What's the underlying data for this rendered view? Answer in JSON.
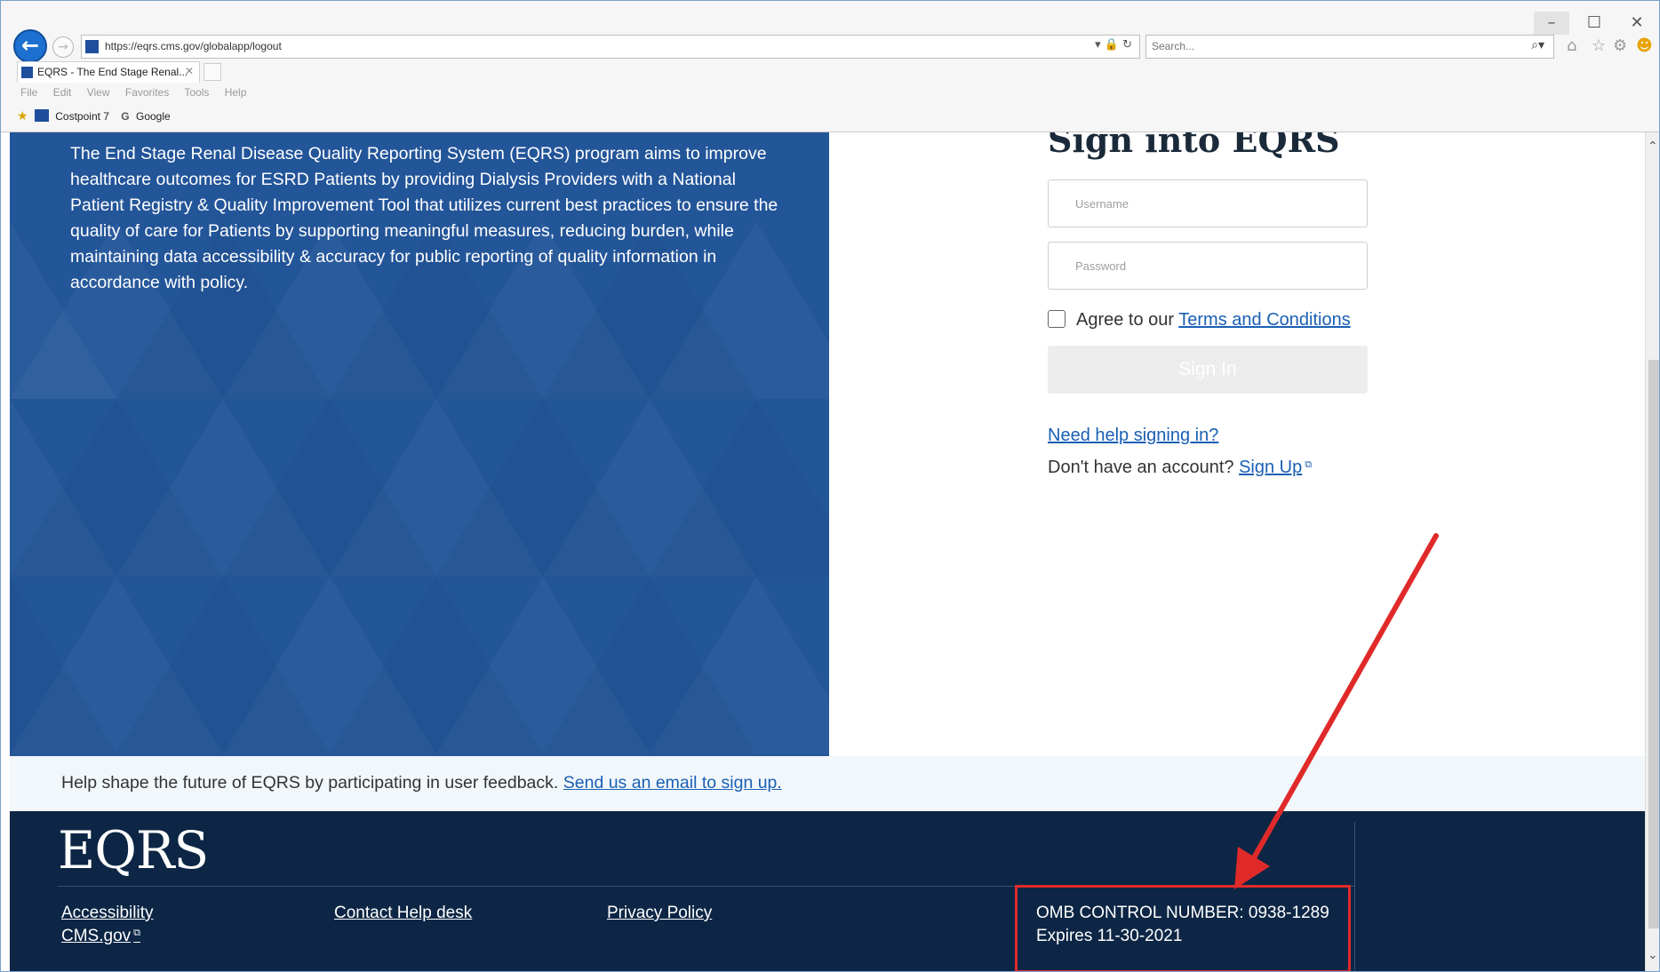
{
  "window": {
    "minimize": "–",
    "maximize": "☐",
    "close": "✕"
  },
  "browser": {
    "url": "https://eqrs.cms.gov/globalapp/logout",
    "address_tools": "▾ 🔒 ↻",
    "search_placeholder": "Search...",
    "tab_title": "EQRS - The End Stage Renal...",
    "tab_close": "✕",
    "menu": [
      "File",
      "Edit",
      "View",
      "Favorites",
      "Tools",
      "Help"
    ],
    "favorites": [
      "Costpoint 7",
      "Google"
    ],
    "icons": [
      "back-arrow-icon",
      "forward-arrow-icon",
      "lock-icon",
      "refresh-icon",
      "search-icon",
      "home-icon",
      "star-icon",
      "gear-icon",
      "smiley-icon"
    ]
  },
  "hero": {
    "description": "The End Stage Renal Disease Quality Reporting System (EQRS) program aims to improve healthcare outcomes for ESRD Patients by providing Dialysis Providers with a National Patient Registry & Quality Improvement Tool that utilizes current best practices to ensure the quality of care for Patients by supporting meaningful measures, reducing burden, while maintaining data accessibility & accuracy for public reporting of quality information in accordance with policy.",
    "background_color": "#235599"
  },
  "login": {
    "heading": "Sign into EQRS",
    "username_placeholder": "Username",
    "password_placeholder": "Password",
    "agree_prefix": "Agree to our ",
    "terms_link": "Terms and Conditions",
    "sign_in_label": "Sign In",
    "help_link": "Need help signing in?",
    "no_account_text": "Don't have an account? ",
    "sign_up_link": "Sign Up"
  },
  "feedback": {
    "text": "Help shape the future of EQRS by participating in user feedback. ",
    "link": "Send us an email to sign up."
  },
  "footer": {
    "logo": "EQRS",
    "links": {
      "accessibility": "Accessibility",
      "cms_gov": "CMS.gov",
      "contact": "Contact Help desk",
      "privacy": "Privacy Policy"
    },
    "omb_number": "OMB CONTROL NUMBER: 0938-1289",
    "omb_expires": "Expires 11-30-2021",
    "background_color": "#0d2645",
    "highlight_color": "#e02a2a"
  },
  "scrollbar": {
    "up": "⌃",
    "down": "⌄"
  }
}
